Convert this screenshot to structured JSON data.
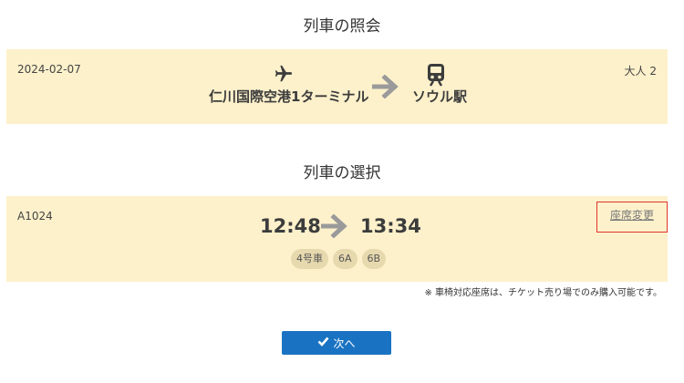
{
  "inquiry": {
    "title": "列車の照会",
    "date": "2024-02-07",
    "passengers": "大人 2",
    "from_station": "仁川国際空港1ターミナル",
    "to_station": "ソウル駅",
    "from_icon": "airplane-icon",
    "to_icon": "train-icon"
  },
  "selection": {
    "title": "列車の選択",
    "train_number": "A1024",
    "seat_change_label": "座席変更",
    "departure_time": "12:48",
    "arrival_time": "13:34",
    "car": "4号車",
    "seats": [
      "6A",
      "6B"
    ]
  },
  "notice": "※ 車椅対応座席は、チケット売り場でのみ購入可能です。",
  "next_button": {
    "label": "次へ",
    "icon": "check-icon"
  },
  "colors": {
    "panel_bg": "#fdf1cb",
    "chip_bg": "#e7d9ae",
    "button_bg": "#1a73c2",
    "highlight_border": "#e0342b",
    "arrow": "#9a9a9a"
  }
}
